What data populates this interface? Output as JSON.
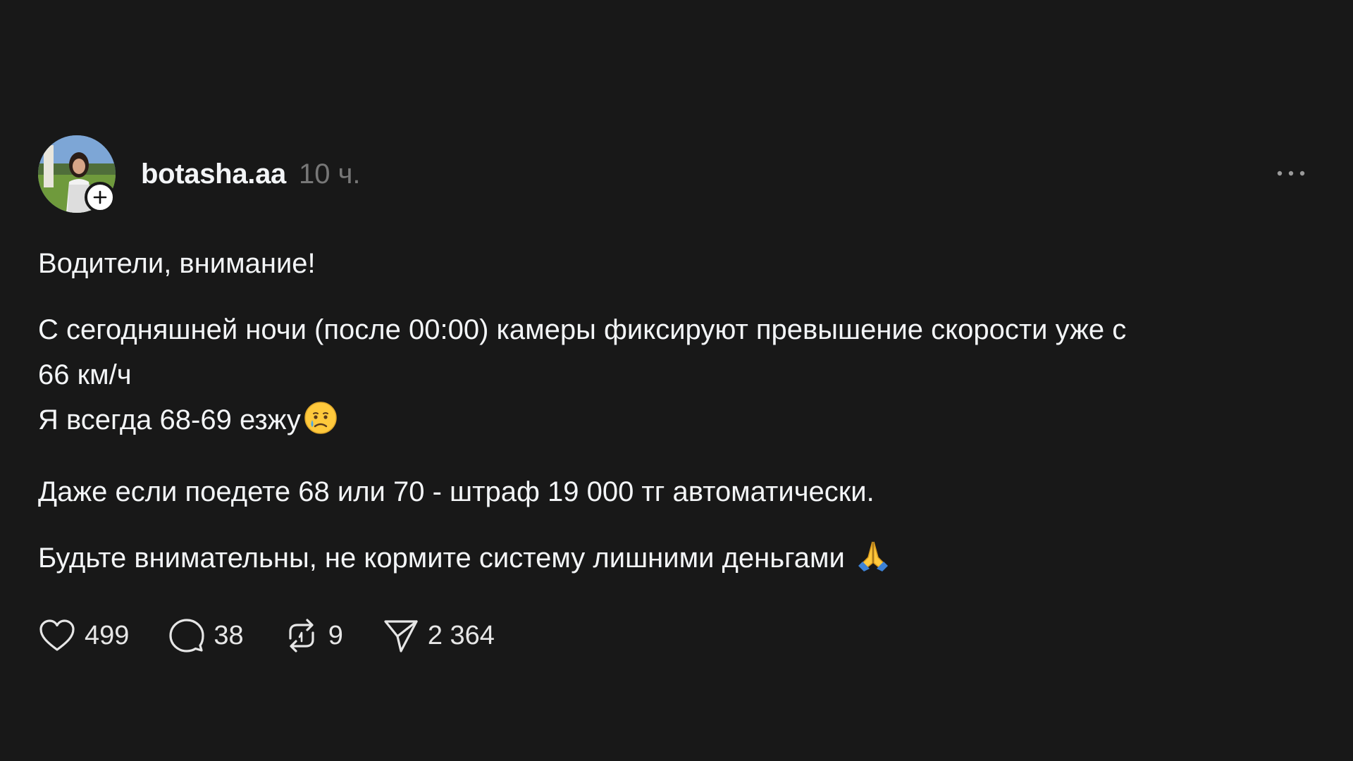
{
  "post": {
    "username": "botasha.aa",
    "time": "10 ч.",
    "paragraphs": [
      {
        "lines": [
          "Водители, внимание!"
        ]
      },
      {
        "lines": [
          "С сегодняшней ночи (после 00:00) камеры фиксируют превышение скорости уже с",
          "66 км/ч",
          "Я всегда 68-69 езжу"
        ]
      },
      {
        "lines": [
          "Даже если поедете 68 или 70 - штраф 19 000 тг автоматически."
        ]
      },
      {
        "lines": [
          "Будьте внимательны, не кормите систему лишними деньгами "
        ]
      }
    ],
    "emojis": {
      "sad": "crying-face-emoji",
      "pray": "folded-hands-emoji"
    }
  },
  "actions": {
    "likes": "499",
    "comments": "38",
    "reposts": "9",
    "shares": "2 364"
  },
  "icons": {
    "like": "heart-icon",
    "comment": "comment-bubble-icon",
    "repost": "repost-icon",
    "share": "send-icon",
    "more": "more-dots-icon",
    "follow": "plus-icon"
  },
  "colors": {
    "background": "#181818",
    "text": "#f3f5f7",
    "secondary": "#777777"
  }
}
